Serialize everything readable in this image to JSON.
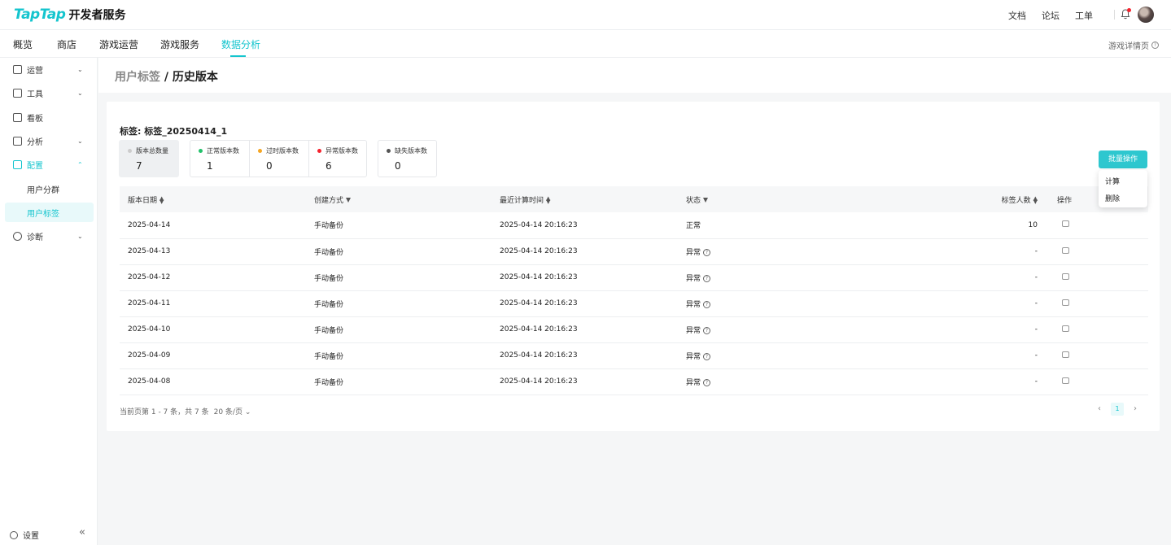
{
  "header": {
    "logo_main": "TapTap",
    "logo_sub": "开发者服务",
    "links": [
      "文档",
      "论坛",
      "工单"
    ]
  },
  "nav": {
    "tabs": [
      "概览",
      "商店",
      "游戏运营",
      "游戏服务",
      "数据分析"
    ],
    "active": "数据分析",
    "detail_link": "游戏详情页"
  },
  "sidebar": {
    "items": [
      {
        "label": "运营",
        "icon": "bar-chart-icon",
        "expandable": true
      },
      {
        "label": "工具",
        "icon": "toolbox-icon",
        "expandable": true
      },
      {
        "label": "看板",
        "icon": "board-icon",
        "expandable": false
      },
      {
        "label": "分析",
        "icon": "clipboard-icon",
        "expandable": true
      },
      {
        "label": "配置",
        "icon": "layout-icon",
        "expandable": true,
        "expanded": true
      },
      {
        "label": "诊断",
        "icon": "search-icon",
        "expandable": true
      }
    ],
    "sub_items": [
      "用户分群",
      "用户标签"
    ],
    "selected_sub": "用户标签",
    "settings": "设置"
  },
  "breadcrumb": {
    "parent": "用户标签",
    "separator": " / ",
    "current": "历史版本"
  },
  "tag_title": "标签: 标签_20250414_1",
  "stats": {
    "total": {
      "label": "版本总数量",
      "value": "7"
    },
    "normal": {
      "label": "正常版本数",
      "value": "1",
      "color": "#23c16b"
    },
    "expired": {
      "label": "过时版本数",
      "value": "0",
      "color": "#f5a623"
    },
    "abnormal": {
      "label": "异常版本数",
      "value": "6",
      "color": "#f5222d"
    },
    "missing": {
      "label": "缺失版本数",
      "value": "0",
      "color": "#555555"
    }
  },
  "batch": {
    "button": "批量操作",
    "menu": [
      "计算",
      "删除"
    ]
  },
  "table": {
    "columns": [
      "版本日期",
      "创建方式",
      "最近计算时间",
      "状态",
      "标签人数",
      "操作"
    ],
    "rows": [
      {
        "date": "2025-04-14",
        "method": "手动备份",
        "time": "2025-04-14 20:16:23",
        "status": "正常",
        "count": "10",
        "status_help": false
      },
      {
        "date": "2025-04-13",
        "method": "手动备份",
        "time": "2025-04-14 20:16:23",
        "status": "异常",
        "count": "-",
        "status_help": true
      },
      {
        "date": "2025-04-12",
        "method": "手动备份",
        "time": "2025-04-14 20:16:23",
        "status": "异常",
        "count": "-",
        "status_help": true
      },
      {
        "date": "2025-04-11",
        "method": "手动备份",
        "time": "2025-04-14 20:16:23",
        "status": "异常",
        "count": "-",
        "status_help": true
      },
      {
        "date": "2025-04-10",
        "method": "手动备份",
        "time": "2025-04-14 20:16:23",
        "status": "异常",
        "count": "-",
        "status_help": true
      },
      {
        "date": "2025-04-09",
        "method": "手动备份",
        "time": "2025-04-14 20:16:23",
        "status": "异常",
        "count": "-",
        "status_help": true
      },
      {
        "date": "2025-04-08",
        "method": "手动备份",
        "time": "2025-04-14 20:16:23",
        "status": "异常",
        "count": "-",
        "status_help": true
      }
    ]
  },
  "pagination": {
    "info": "当前页第 1 - 7 条，共 7 条",
    "page_size": "20 条/页",
    "current_page": "1"
  }
}
